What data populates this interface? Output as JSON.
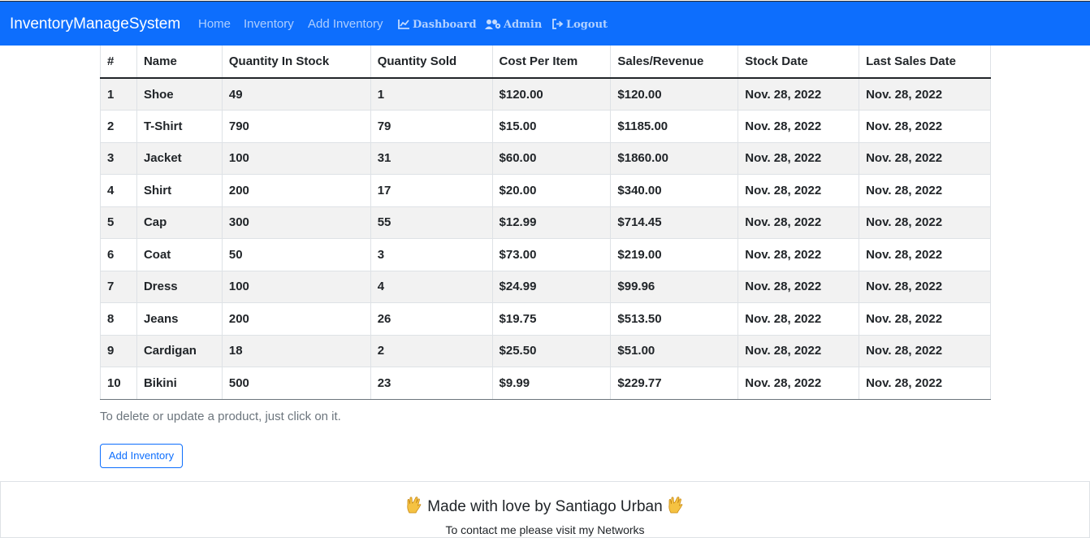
{
  "navbar": {
    "brand": "InventoryManageSystem",
    "links": [
      {
        "label": "Home"
      },
      {
        "label": "Inventory"
      },
      {
        "label": "Add Inventory"
      },
      {
        "label": "Dashboard",
        "icon": "chart-line-icon"
      },
      {
        "label": "Admin",
        "icon": "users-cog-icon"
      },
      {
        "label": "Logout",
        "icon": "sign-out-icon"
      }
    ],
    "color": "#0d6efd"
  },
  "table": {
    "headers": [
      "#",
      "Name",
      "Quantity In Stock",
      "Quantity Sold",
      "Cost Per Item",
      "Sales/Revenue",
      "Stock Date",
      "Last Sales Date"
    ],
    "rows": [
      [
        "1",
        "Shoe",
        "49",
        "1",
        "$120.00",
        "$120.00",
        "Nov. 28, 2022",
        "Nov. 28, 2022"
      ],
      [
        "2",
        "T-Shirt",
        "790",
        "79",
        "$15.00",
        "$1185.00",
        "Nov. 28, 2022",
        "Nov. 28, 2022"
      ],
      [
        "3",
        "Jacket",
        "100",
        "31",
        "$60.00",
        "$1860.00",
        "Nov. 28, 2022",
        "Nov. 28, 2022"
      ],
      [
        "4",
        "Shirt",
        "200",
        "17",
        "$20.00",
        "$340.00",
        "Nov. 28, 2022",
        "Nov. 28, 2022"
      ],
      [
        "5",
        "Cap",
        "300",
        "55",
        "$12.99",
        "$714.45",
        "Nov. 28, 2022",
        "Nov. 28, 2022"
      ],
      [
        "6",
        "Coat",
        "50",
        "3",
        "$73.00",
        "$219.00",
        "Nov. 28, 2022",
        "Nov. 28, 2022"
      ],
      [
        "7",
        "Dress",
        "100",
        "4",
        "$24.99",
        "$99.96",
        "Nov. 28, 2022",
        "Nov. 28, 2022"
      ],
      [
        "8",
        "Jeans",
        "200",
        "26",
        "$19.75",
        "$513.50",
        "Nov. 28, 2022",
        "Nov. 28, 2022"
      ],
      [
        "9",
        "Cardigan",
        "18",
        "2",
        "$25.50",
        "$51.00",
        "Nov. 28, 2022",
        "Nov. 28, 2022"
      ],
      [
        "10",
        "Bikini",
        "500",
        "23",
        "$9.99",
        "$229.77",
        "Nov. 28, 2022",
        "Nov. 28, 2022"
      ]
    ]
  },
  "hint": "To delete or update a product, just click on it.",
  "add_button_label": "Add Inventory",
  "footer": {
    "title": "Made with love by Santiago Urban",
    "icon": "vulcan-salute-icon",
    "subtitle": "To contact me please visit my Networks"
  }
}
